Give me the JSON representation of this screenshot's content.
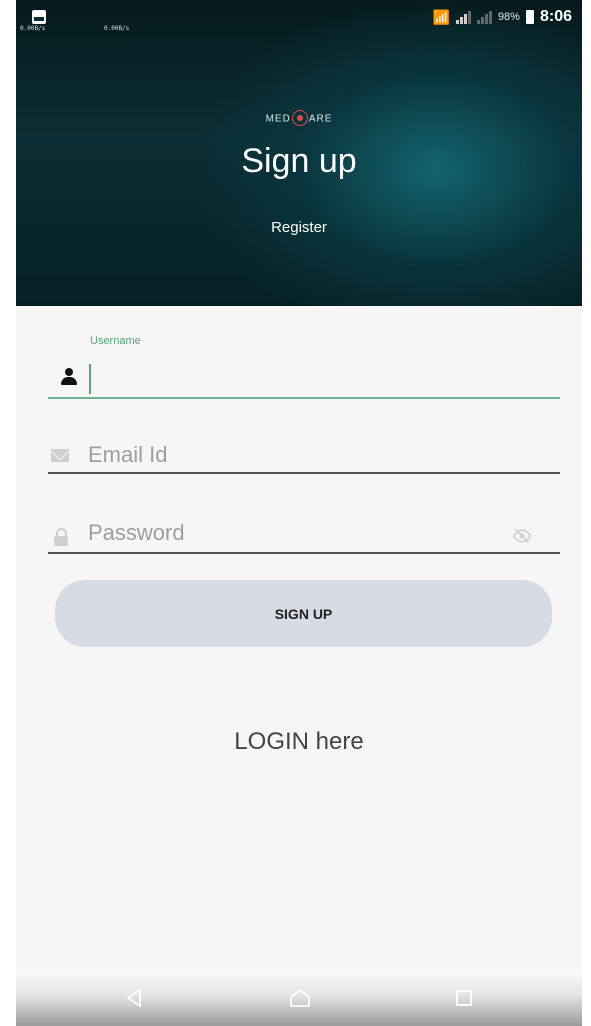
{
  "statusbar": {
    "speed_1": "0.00B/s",
    "speed_2": "0.00B/s",
    "battery_pct": "98%",
    "clock": "8:06"
  },
  "header": {
    "logo_left": "MED",
    "logo_right": "ARE",
    "title": "Sign up",
    "subtitle": "Register"
  },
  "form": {
    "username_label": "Username",
    "username_value": "",
    "email_placeholder": "Email Id",
    "password_placeholder": "Password",
    "signup_button": "SIGN UP",
    "login_link": "LOGIN here"
  },
  "colors": {
    "accent": "#54a778",
    "button_bg": "#d7dbe5",
    "header_dark": "#0a2e35"
  },
  "icons": {
    "username": "person-icon",
    "email": "mail-icon",
    "password": "lock-icon",
    "visibility": "eye-off-icon",
    "nav_back": "back-triangle-icon",
    "nav_home": "home-icon",
    "nav_recents": "recents-square-icon"
  }
}
